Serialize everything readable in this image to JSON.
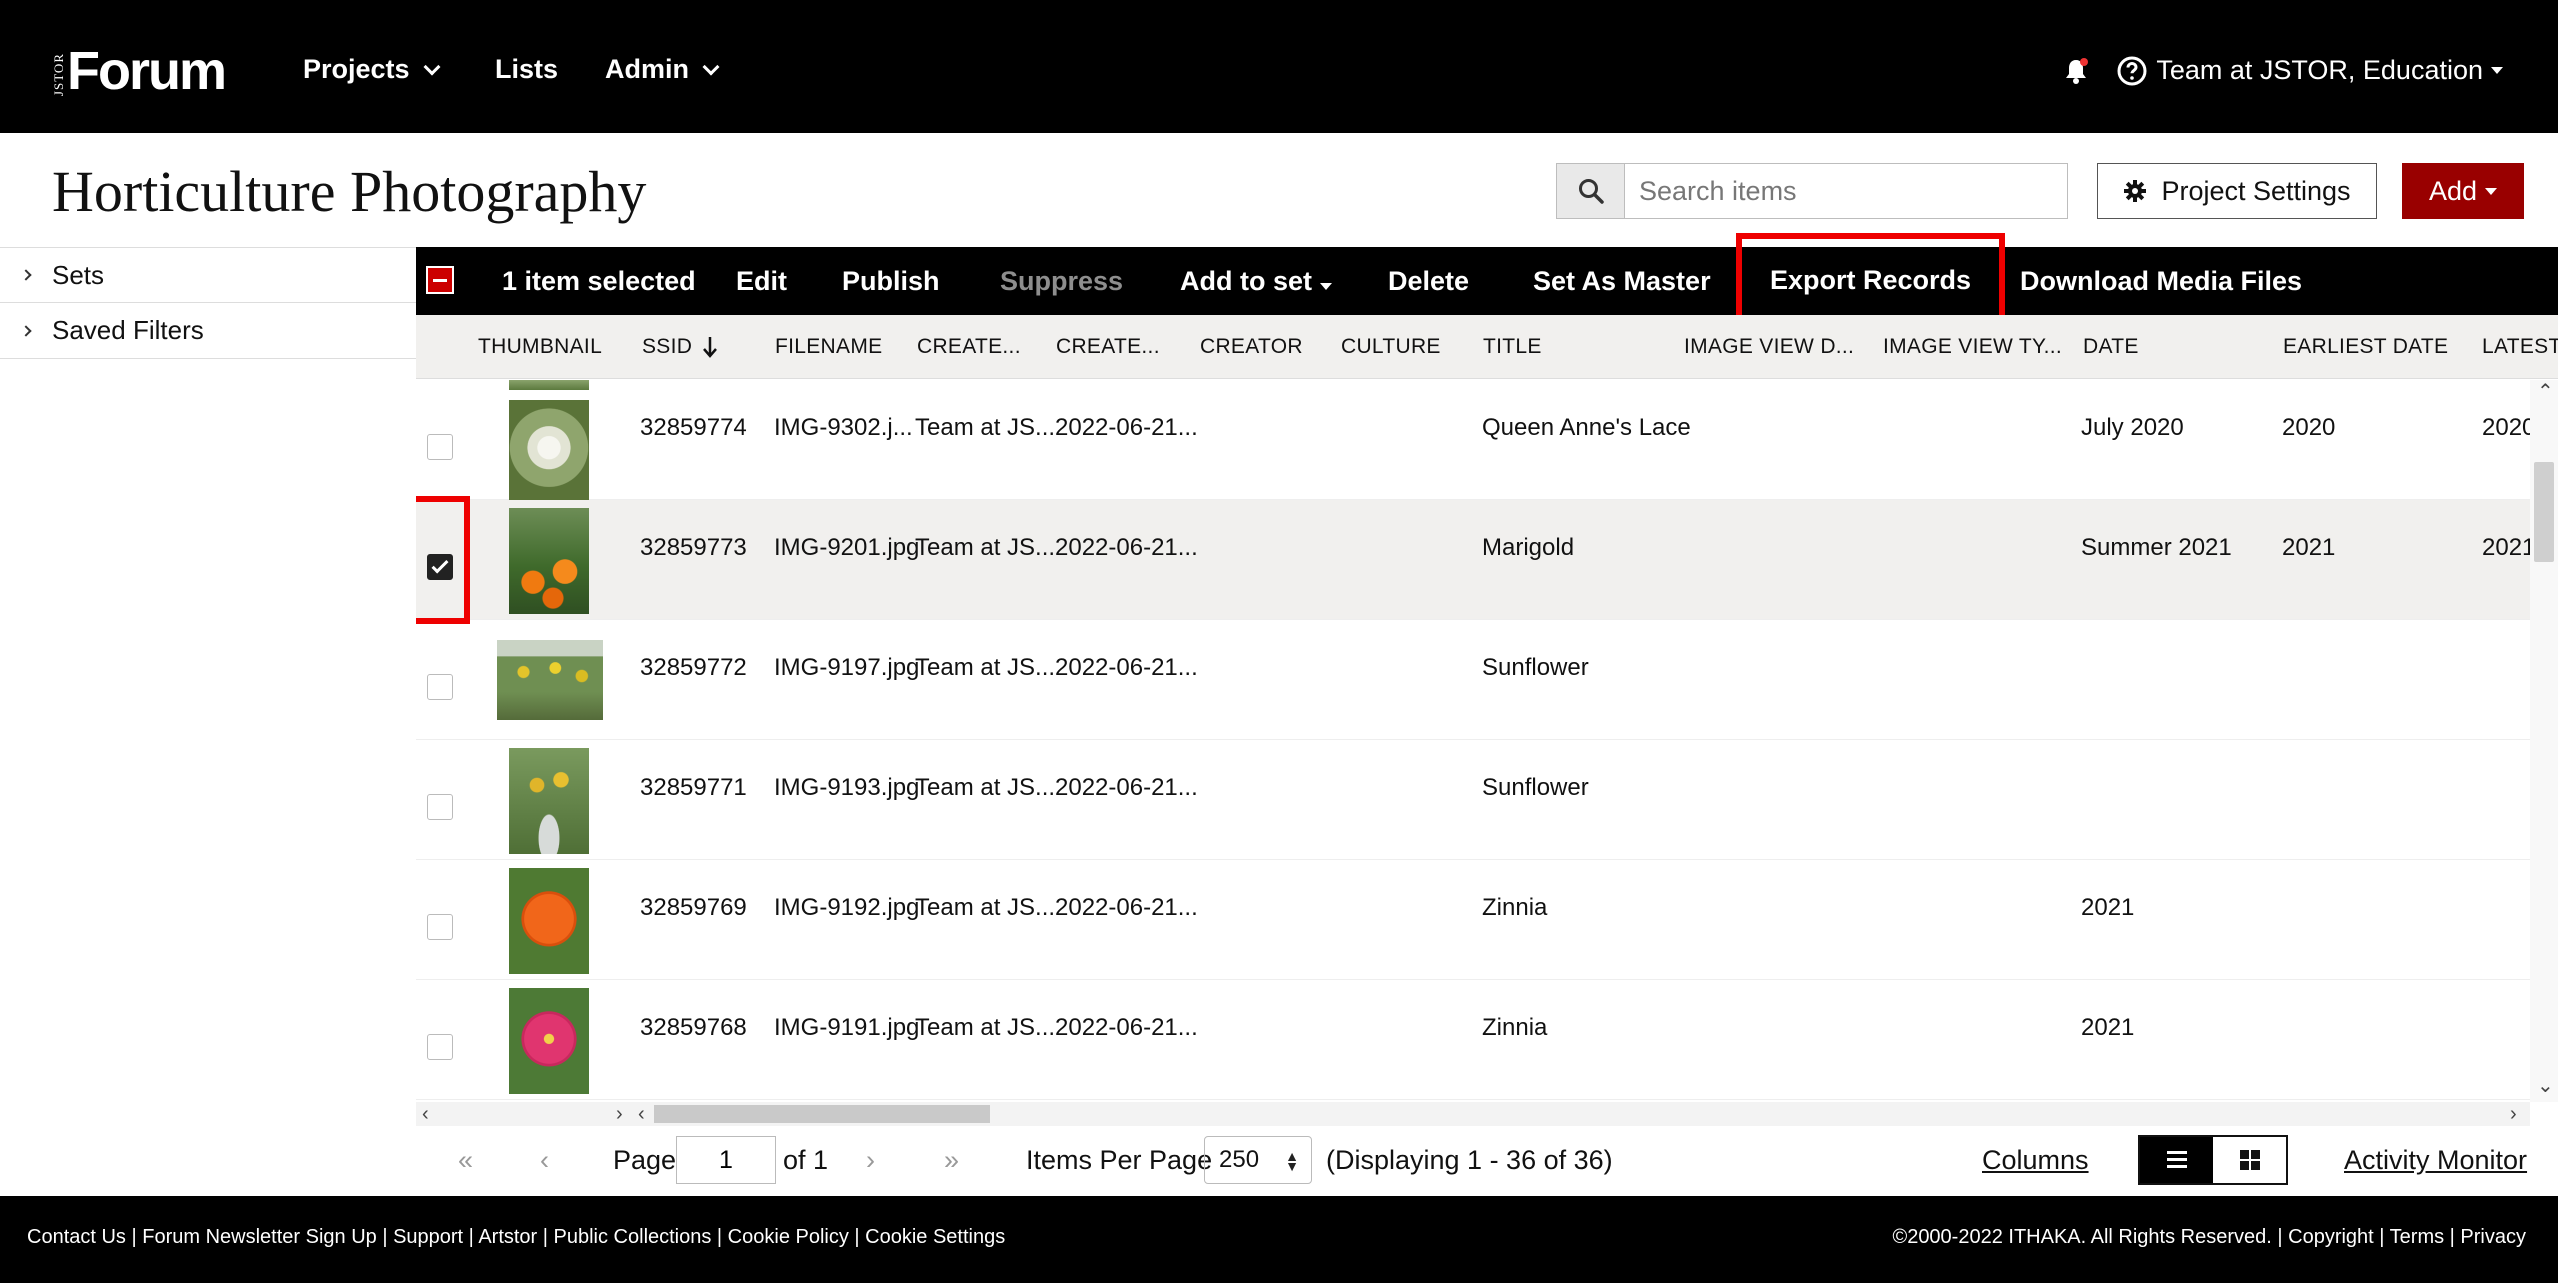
{
  "nav": {
    "logo_small": "JSTOR",
    "logo": "Forum",
    "projects": "Projects",
    "lists": "Lists",
    "admin": "Admin",
    "user": "Team at JSTOR, Education"
  },
  "project": {
    "title": "Horticulture Photography",
    "search_placeholder": "Search items",
    "settings_label": "Project Settings",
    "add_label": "Add"
  },
  "sidebar": {
    "items": [
      {
        "label": "Sets"
      },
      {
        "label": "Saved Filters"
      }
    ]
  },
  "actions": {
    "selected": "1 item selected",
    "edit": "Edit",
    "publish": "Publish",
    "suppress": "Suppress",
    "add_to_set": "Add to set",
    "delete": "Delete",
    "set_as_master": "Set As Master",
    "export_records": "Export Records",
    "download_media": "Download Media Files"
  },
  "columns": [
    "THUMBNAIL",
    "SSID",
    "FILENAME",
    "CREATE...",
    "CREATE...",
    "CREATOR",
    "CULTURE",
    "TITLE",
    "IMAGE VIEW D...",
    "IMAGE VIEW TY...",
    "DATE",
    "EARLIEST DATE",
    "LATEST"
  ],
  "rows": [
    {
      "ssid": "32859774",
      "filename": "IMG-9302.j...",
      "created_by": "Team at JS...",
      "created_on": "2022-06-21...",
      "title": "Queen Anne's Lace",
      "date": "July 2020",
      "earliest": "2020",
      "latest": "2020",
      "selected": false
    },
    {
      "ssid": "32859773",
      "filename": "IMG-9201.jpg",
      "created_by": "Team at JS...",
      "created_on": "2022-06-21...",
      "title": "Marigold",
      "date": "Summer 2021",
      "earliest": "2021",
      "latest": "2021",
      "selected": true
    },
    {
      "ssid": "32859772",
      "filename": "IMG-9197.jpg",
      "created_by": "Team at JS...",
      "created_on": "2022-06-21...",
      "title": "Sunflower",
      "date": "",
      "earliest": "",
      "latest": "",
      "selected": false
    },
    {
      "ssid": "32859771",
      "filename": "IMG-9193.jpg",
      "created_by": "Team at JS...",
      "created_on": "2022-06-21...",
      "title": "Sunflower",
      "date": "",
      "earliest": "",
      "latest": "",
      "selected": false
    },
    {
      "ssid": "32859769",
      "filename": "IMG-9192.jpg",
      "created_by": "Team at JS...",
      "created_on": "2022-06-21...",
      "title": "Zinnia",
      "date": "2021",
      "earliest": "",
      "latest": "",
      "selected": false
    },
    {
      "ssid": "32859768",
      "filename": "IMG-9191.jpg",
      "created_by": "Team at JS...",
      "created_on": "2022-06-21...",
      "title": "Zinnia",
      "date": "2021",
      "earliest": "",
      "latest": "",
      "selected": false
    }
  ],
  "pagination": {
    "page_label": "Page",
    "page_value": "1",
    "of_label": "of 1",
    "ipp_label": "Items Per Page",
    "ipp_value": "250",
    "displaying": "(Displaying 1 - 36 of 36)",
    "columns_link": "Columns",
    "activity_monitor": "Activity Monitor"
  },
  "footer": {
    "left": "Contact Us | Forum Newsletter Sign Up | Support | Artstor | Public Collections | Cookie Policy |  Cookie Settings",
    "right": "©2000-2022 ITHAKA. All Rights Reserved. | Copyright | Terms | Privacy"
  },
  "colors": {
    "brand_red": "#990000",
    "highlight_red": "#e00000",
    "header_black": "#000000"
  }
}
